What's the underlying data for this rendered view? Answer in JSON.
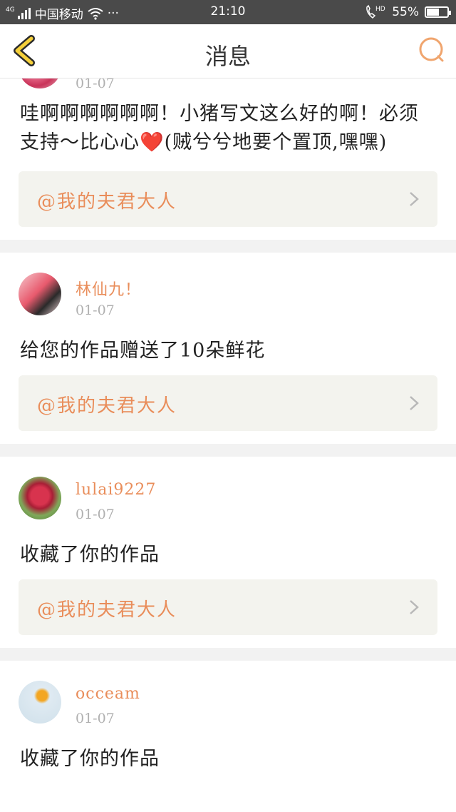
{
  "status_bar": {
    "network": "4G",
    "carrier": "中国移动",
    "more": "···",
    "time": "21:10",
    "hd_label": "HD",
    "battery_pct": "55%",
    "battery_level": 0.55
  },
  "header": {
    "title": "消息"
  },
  "messages": [
    {
      "date": "01-07",
      "text": "哇啊啊啊啊啊啊！小猪写文这么好的啊！必须支持～比心心❤️(贼兮兮地要个置顶,嘿嘿)",
      "ref": "@我的夫君大人"
    },
    {
      "username": "林仙九！",
      "date": "01-07",
      "text": "给您的作品赠送了10朵鲜花",
      "ref": "@我的夫君大人"
    },
    {
      "username": "lulai9227",
      "date": "01-07",
      "text": "收藏了你的作品",
      "ref": "@我的夫君大人"
    },
    {
      "username": "occeam",
      "date": "01-07",
      "text": "收藏了你的作品"
    }
  ]
}
